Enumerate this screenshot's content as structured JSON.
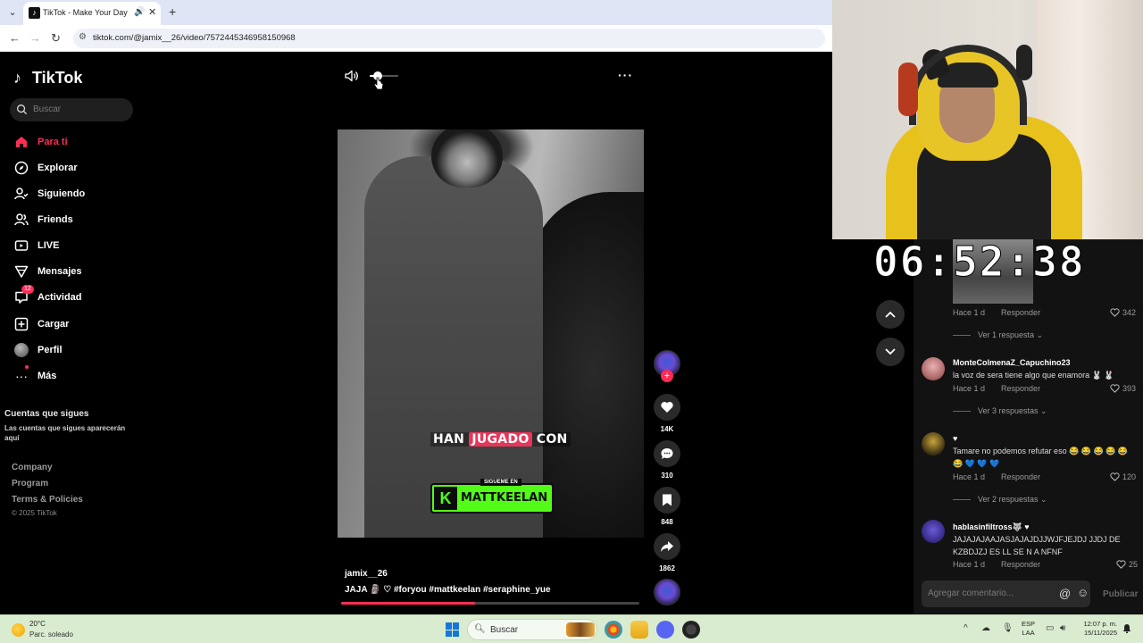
{
  "browser": {
    "tab_title": "TikTok - Make Your Day",
    "url": "tiktok.com/@jamix__26/video/7572445346958150968"
  },
  "sidebar": {
    "logo_text": "TikTok",
    "search_placeholder": "Buscar",
    "items": [
      {
        "label": "Para ti",
        "icon": "home-icon",
        "active": true
      },
      {
        "label": "Explorar",
        "icon": "compass-icon"
      },
      {
        "label": "Siguiendo",
        "icon": "following-icon"
      },
      {
        "label": "Friends",
        "icon": "friends-icon"
      },
      {
        "label": "LIVE",
        "icon": "live-icon"
      },
      {
        "label": "Mensajes",
        "icon": "messages-icon"
      },
      {
        "label": "Actividad",
        "icon": "activity-icon",
        "badge": "12"
      },
      {
        "label": "Cargar",
        "icon": "upload-icon"
      },
      {
        "label": "Perfil",
        "icon": "avatar"
      },
      {
        "label": "Más",
        "icon": "more-icon"
      }
    ],
    "following_title": "Cuentas que sigues",
    "following_desc": "Las cuentas que sigues aparecerán aquí",
    "footer_links": [
      "Company",
      "Program",
      "Terms & Policies"
    ],
    "copyright": "© 2025 TikTok"
  },
  "video": {
    "caption_before": "HAN ",
    "caption_highlight": "JUGADO",
    "caption_after": " CON",
    "kick_tag": "SIGUEME EN",
    "kick_letter": "K",
    "kick_name": "MATTKEELAN",
    "author": "jamix__26",
    "description": "JAJA 🗿 ♡ #foryou  #mattkeelan  #seraphine_yue",
    "progress": 0.45,
    "volume": 0.3
  },
  "actions": {
    "likes": "14K",
    "comments": "310",
    "saves": "848",
    "shares": "1862"
  },
  "stream": {
    "timer": "06:52:38"
  },
  "comments": {
    "items": [
      {
        "user": "",
        "text": "",
        "time": "Hace 1 d",
        "reply_label": "Responder",
        "likes": "342",
        "replies": "Ver 1 respuesta"
      },
      {
        "user": "MonteColmenaZ_Capuchino23",
        "text": "la voz de sera tiene algo que enamora 🐰 🐰",
        "time": "Hace 1 d",
        "reply_label": "Responder",
        "likes": "393",
        "replies": "Ver 3 respuestas"
      },
      {
        "user": "♥",
        "text": "Tamare no podemos refutar eso 😂 😂 😂 😂 😂 😂 💙 💙 💙",
        "time": "Hace 1 d",
        "reply_label": "Responder",
        "likes": "120",
        "replies": "Ver 2 respuestas"
      },
      {
        "user": "hablasinfiltross🐺 ♥",
        "text": "JAJAJAJAAJASJAJAJDJJWJFJEJDJ JJDJ DE KZBDJZJ ES LL SE N A NFNF",
        "time": "Hace 1 d",
        "reply_label": "Responder",
        "likes": "25"
      }
    ],
    "input_placeholder": "Agregar comentario...",
    "publish_label": "Publicar"
  },
  "taskbar": {
    "temp": "20°C",
    "weather": "Parc. soleado",
    "search_label": "Buscar",
    "lang_line1": "ESP",
    "lang_line2": "LAA",
    "time": "12:07 p. m.",
    "date": "15/11/2025"
  },
  "colors": {
    "accent": "#fe2c55",
    "kick_green": "#53fc18"
  }
}
